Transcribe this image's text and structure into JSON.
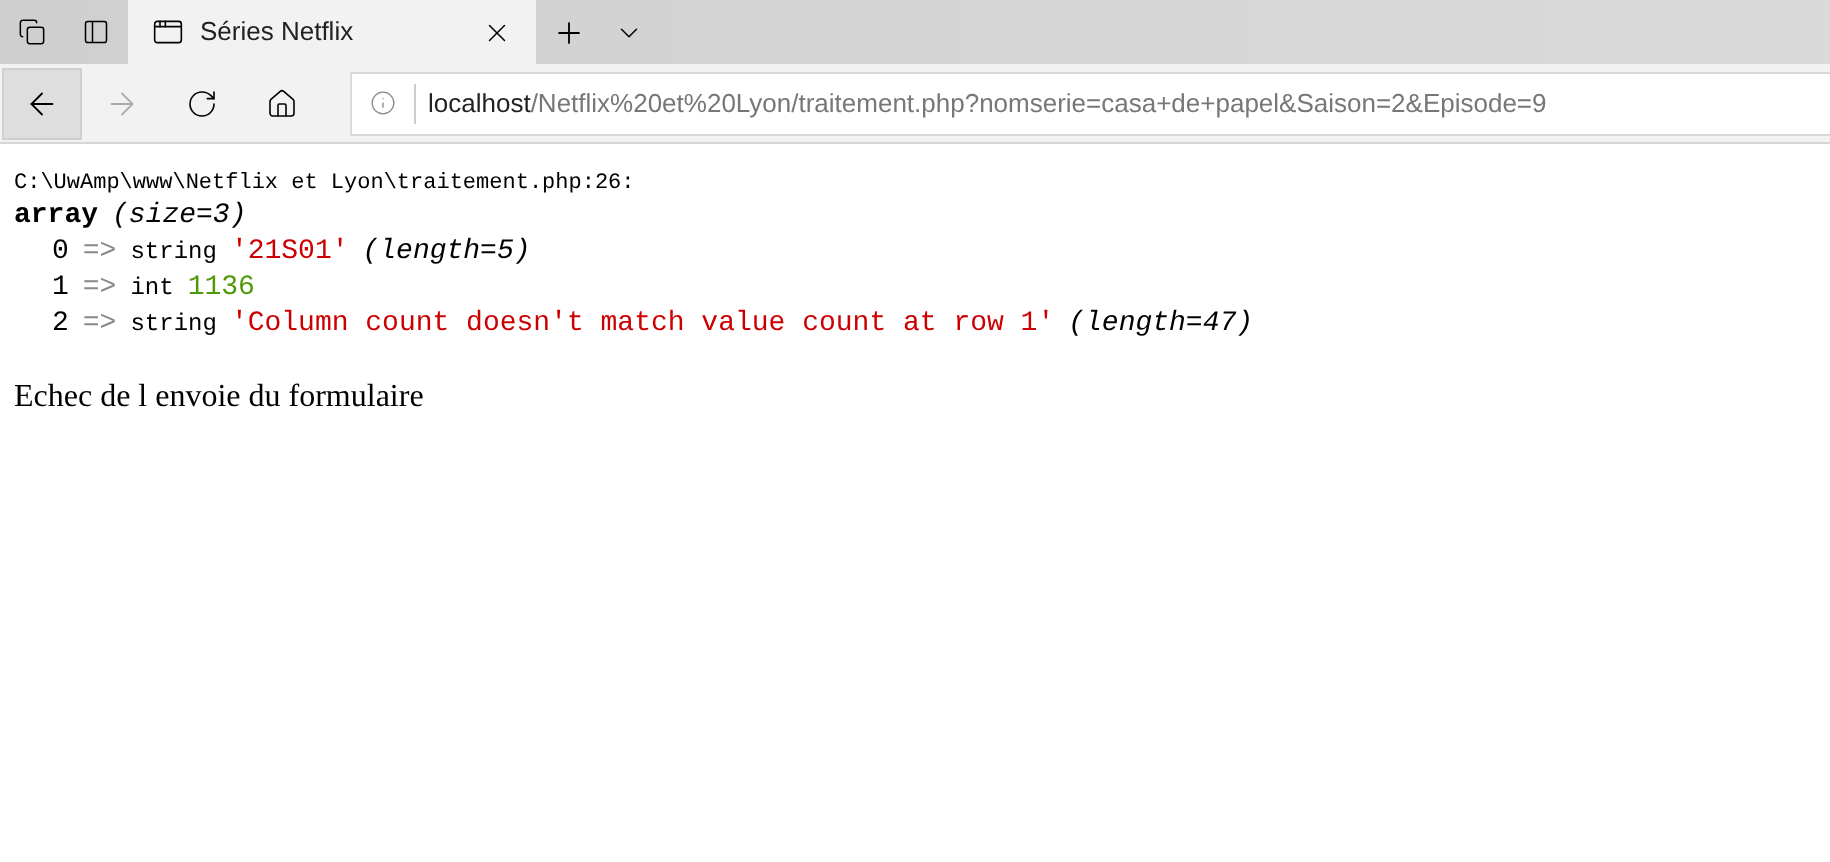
{
  "tab": {
    "title": "Séries Netflix",
    "selected": true
  },
  "address": {
    "host": "localhost",
    "path": "/Netflix%20et%20Lyon/traitement.php?nomserie=casa+de+papel&Saison=2&Episode=9"
  },
  "dump": {
    "location": "C:\\UwAmp\\www\\Netflix et Lyon\\traitement.php:26:",
    "type": "array",
    "size": "(size=3)",
    "entries": [
      {
        "key": "0",
        "arrow": "=>",
        "kind": "string",
        "type": "string",
        "value": "'21S01'",
        "length": "(length=5)"
      },
      {
        "key": "1",
        "arrow": "=>",
        "kind": "int",
        "type": "int",
        "value": "1136"
      },
      {
        "key": "2",
        "arrow": "=>",
        "kind": "string",
        "type": "string",
        "value": "'Column count doesn't match value count at row 1'",
        "length": "(length=47)"
      }
    ]
  },
  "message": "Echec de l envoie du formulaire"
}
